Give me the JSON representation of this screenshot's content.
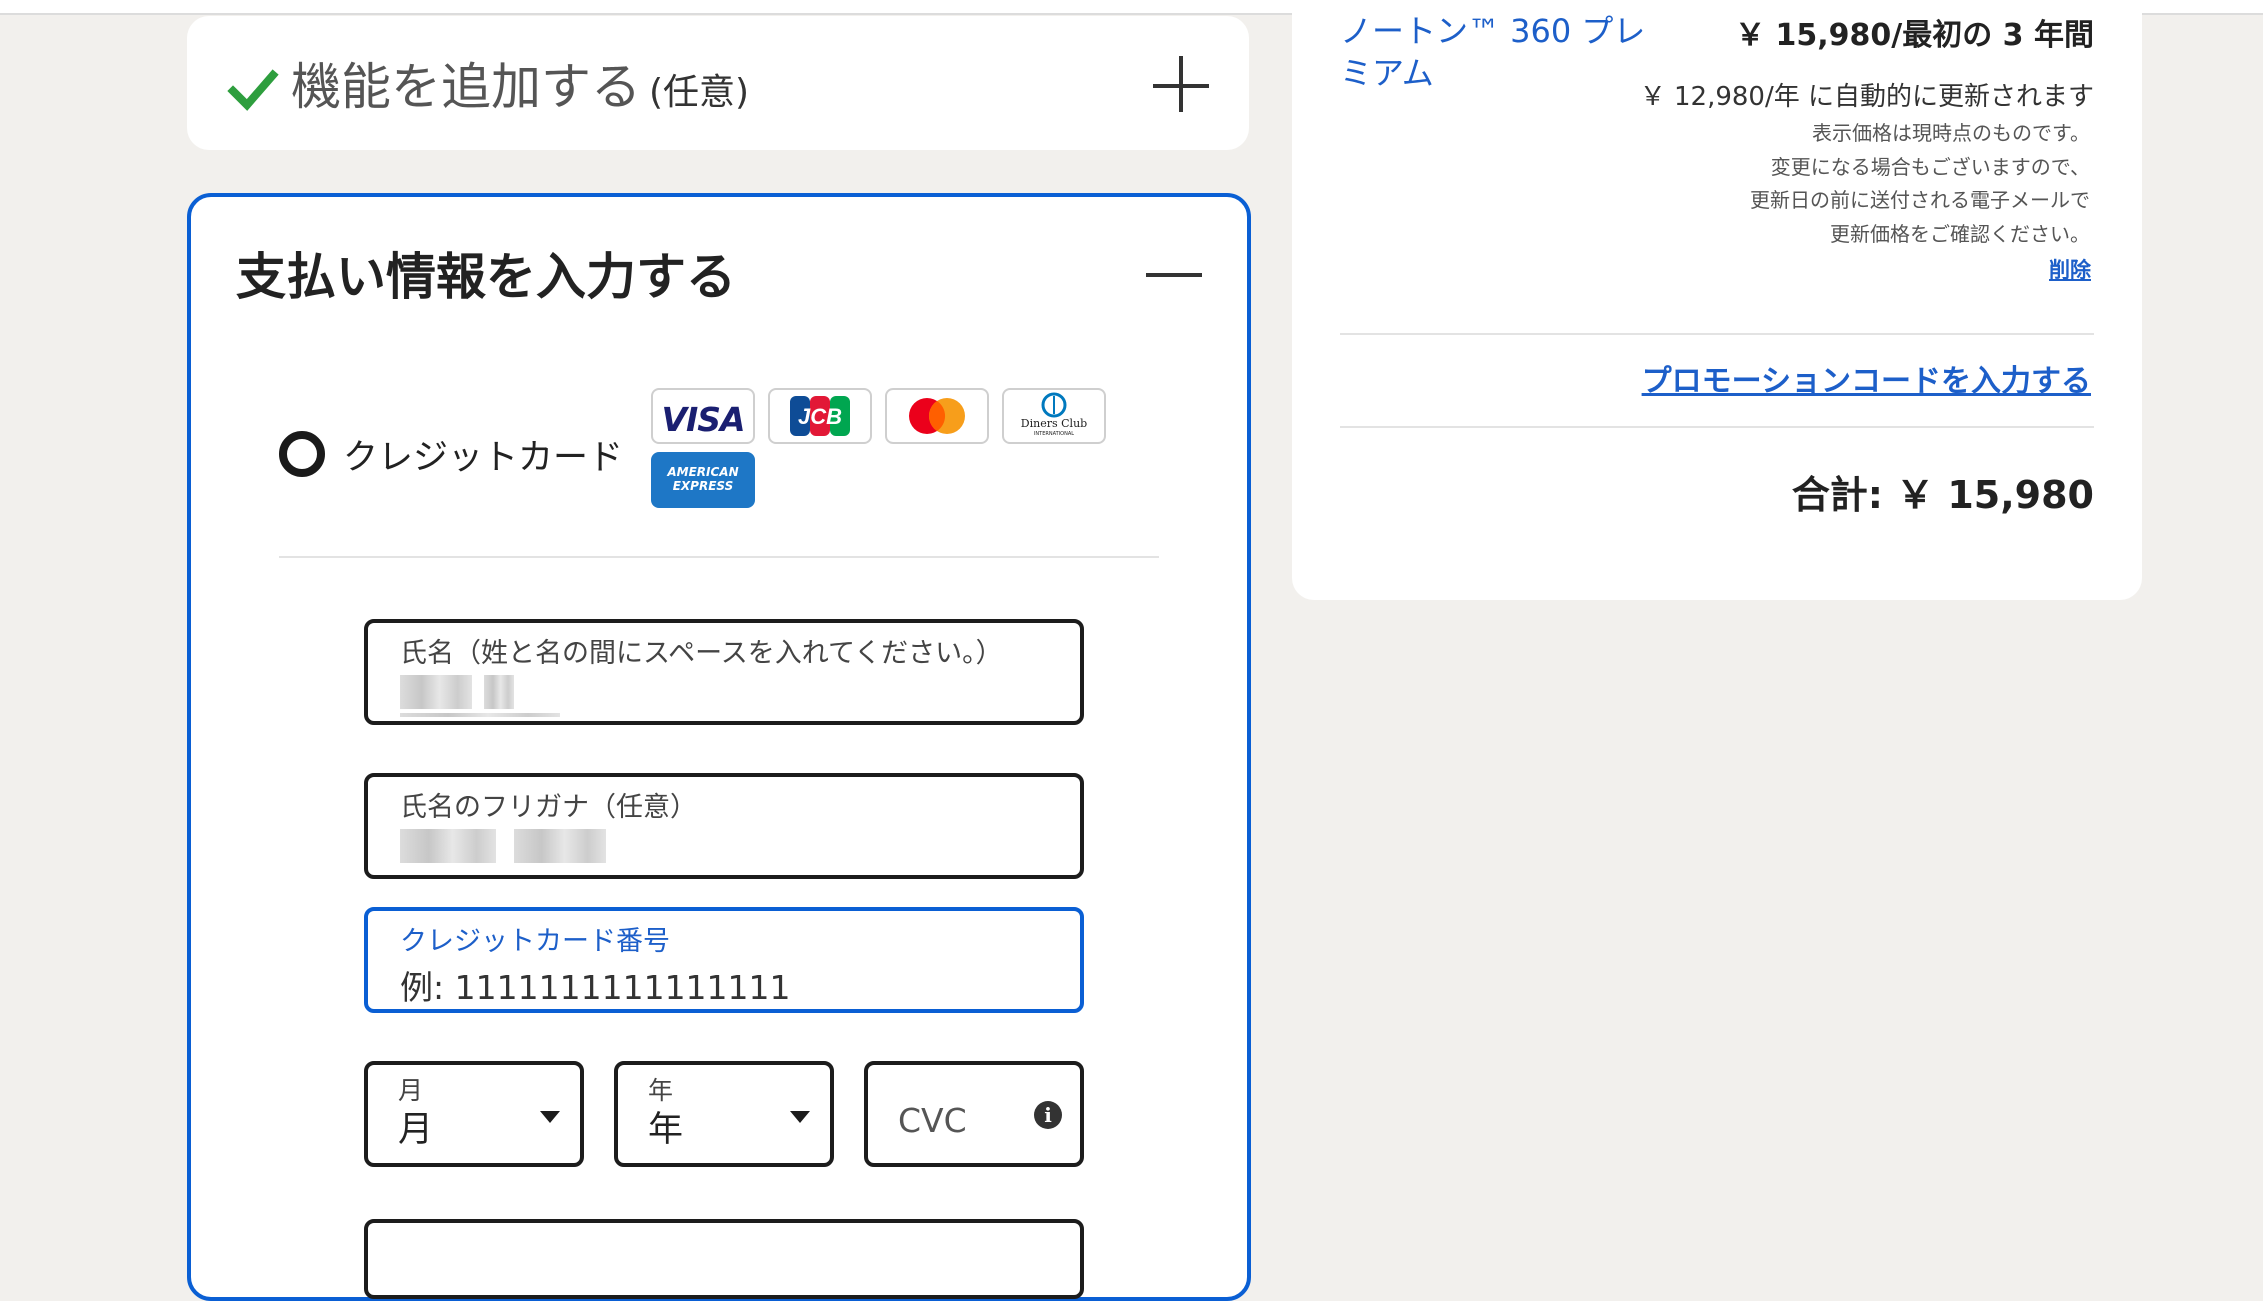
{
  "addons": {
    "title": "機能を追加する",
    "optional": "(任意)",
    "check_icon": "checkmark-icon",
    "expand_icon": "plus-icon"
  },
  "payment": {
    "title": "支払い情報を入力する",
    "collapse_icon": "minus-icon",
    "method_label": "クレジットカード",
    "card_brands": {
      "visa": "VISA",
      "jcb": "JCB",
      "diners": "Diners Club",
      "diners_sub": "INTERNATIONAL",
      "amex": "AMERICAN EXPRESS"
    },
    "fields": {
      "name_label": "氏名（姓と名の間にスペースを入れてください。）",
      "furigana_label": "氏名のフリガナ（任意）",
      "card_number_label": "クレジットカード番号",
      "card_number_placeholder": "例: 1111111111111111",
      "month_label": "月",
      "month_value": "月",
      "year_label": "年",
      "year_value": "年",
      "cvc_placeholder": "CVC",
      "info_icon": "i"
    }
  },
  "summary": {
    "product_name": "ノートン™ 360 プレミアム",
    "price": "￥ 15,980/最初の 3 年間",
    "renewal": "￥ 12,980/年 に自動的に更新されます",
    "note_lines": [
      "表示価格は現時点のものです。",
      "変更になる場合もございますので、",
      "更新日の前に送付される電子メールで",
      "更新価格をご確認ください。"
    ],
    "delete_label": "削除",
    "promo_label": "プロモーションコードを入力する",
    "total": "合計:  ￥ 15,980"
  },
  "colors": {
    "accent_blue": "#0a5fd4",
    "link_blue": "#1d5fc9",
    "check_green": "#2e9e3e",
    "background": "#f2f0ed"
  }
}
